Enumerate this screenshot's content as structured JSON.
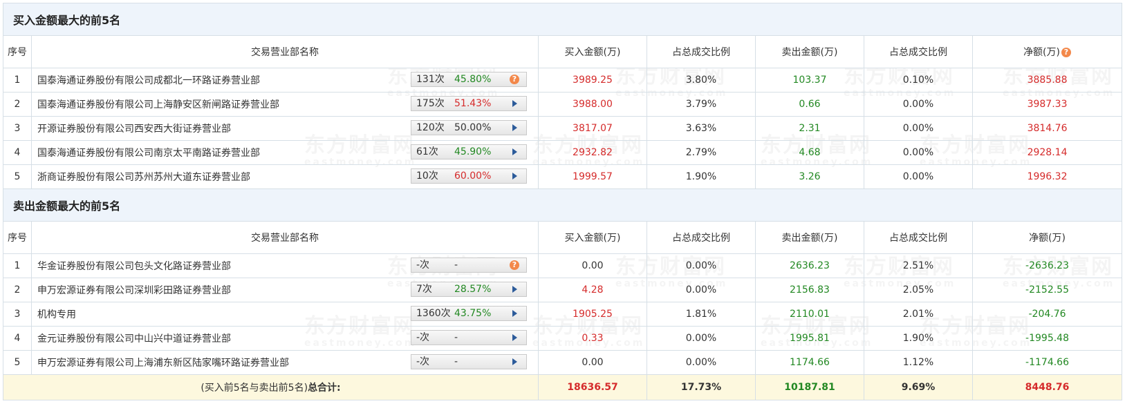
{
  "watermark": {
    "cn": "东方财富网",
    "en": "eastmoney.com"
  },
  "buy_section": {
    "title": "买入金额最大的前5名",
    "headers": [
      "序号",
      "交易营业部名称",
      "买入金额(万)",
      "占总成交比例",
      "卖出金额(万)",
      "占总成交比例",
      "净额(万)"
    ],
    "rows": [
      {
        "idx": "1",
        "name": "国泰海通证券股份有限公司成都北一环路证券营业部",
        "count": "131次",
        "pct": "45.80%",
        "pct_color": "green",
        "control": "help-icon",
        "buy": "3989.25",
        "buy_pct": "3.80%",
        "sell": "103.37",
        "sell_pct": "0.10%",
        "net": "3885.88",
        "net_color": "red"
      },
      {
        "idx": "2",
        "name": "国泰海通证券股份有限公司上海静安区新闸路证券营业部",
        "count": "175次",
        "pct": "51.43%",
        "pct_color": "red",
        "control": "play-arrow-icon",
        "buy": "3988.00",
        "buy_pct": "3.79%",
        "sell": "0.66",
        "sell_pct": "0.00%",
        "net": "3987.33",
        "net_color": "red"
      },
      {
        "idx": "3",
        "name": "开源证券股份有限公司西安西大街证券营业部",
        "count": "120次",
        "pct": "50.00%",
        "pct_color": "gray",
        "control": "play-arrow-icon",
        "buy": "3817.07",
        "buy_pct": "3.63%",
        "sell": "2.31",
        "sell_pct": "0.00%",
        "net": "3814.76",
        "net_color": "red"
      },
      {
        "idx": "4",
        "name": "国泰海通证券股份有限公司南京太平南路证券营业部",
        "count": "61次",
        "pct": "45.90%",
        "pct_color": "green",
        "control": "play-arrow-icon",
        "buy": "2932.82",
        "buy_pct": "2.79%",
        "sell": "4.68",
        "sell_pct": "0.00%",
        "net": "2928.14",
        "net_color": "red"
      },
      {
        "idx": "5",
        "name": "浙商证券股份有限公司苏州苏州大道东证券营业部",
        "count": "10次",
        "pct": "60.00%",
        "pct_color": "red",
        "control": "play-arrow-icon",
        "buy": "1999.57",
        "buy_pct": "1.90%",
        "sell": "3.26",
        "sell_pct": "0.00%",
        "net": "1996.32",
        "net_color": "red"
      }
    ]
  },
  "sell_section": {
    "title": "卖出金额最大的前5名",
    "headers": [
      "序号",
      "交易营业部名称",
      "买入金额(万)",
      "占总成交比例",
      "卖出金额(万)",
      "占总成交比例",
      "净额(万)"
    ],
    "rows": [
      {
        "idx": "1",
        "name": "华金证券股份有限公司包头文化路证券营业部",
        "count": "-次",
        "pct": "-",
        "pct_color": "gray",
        "control": "help-icon",
        "buy": "0.00",
        "buy_color": "gray",
        "buy_pct": "0.00%",
        "sell": "2636.23",
        "sell_pct": "2.51%",
        "net": "-2636.23",
        "net_color": "green"
      },
      {
        "idx": "2",
        "name": "申万宏源证券有限公司深圳彩田路证券营业部",
        "count": "7次",
        "pct": "28.57%",
        "pct_color": "green",
        "control": "play-arrow-icon",
        "buy": "4.28",
        "buy_color": "red",
        "buy_pct": "0.00%",
        "sell": "2156.83",
        "sell_pct": "2.05%",
        "net": "-2152.55",
        "net_color": "green"
      },
      {
        "idx": "3",
        "name": "机构专用",
        "count": "1360次",
        "pct": "43.75%",
        "pct_color": "green",
        "control": "play-arrow-icon",
        "buy": "1905.25",
        "buy_color": "red",
        "buy_pct": "1.81%",
        "sell": "2110.01",
        "sell_pct": "2.01%",
        "net": "-204.76",
        "net_color": "green"
      },
      {
        "idx": "4",
        "name": "金元证券股份有限公司中山兴中道证券营业部",
        "count": "-次",
        "pct": "-",
        "pct_color": "gray",
        "control": "play-arrow-icon",
        "buy": "0.33",
        "buy_color": "red",
        "buy_pct": "0.00%",
        "sell": "1995.81",
        "sell_pct": "1.90%",
        "net": "-1995.48",
        "net_color": "green"
      },
      {
        "idx": "5",
        "name": "申万宏源证券有限公司上海浦东新区陆家嘴环路证券营业部",
        "count": "-次",
        "pct": "-",
        "pct_color": "gray",
        "control": "play-arrow-icon",
        "buy": "0.00",
        "buy_color": "gray",
        "buy_pct": "0.00%",
        "sell": "1174.66",
        "sell_pct": "1.12%",
        "net": "-1174.66",
        "net_color": "green"
      }
    ]
  },
  "summary": {
    "label_prefix": "(买入前5名与卖出前5名)",
    "label_bold": "总合计:",
    "buy": "18636.57",
    "buy_pct": "17.73%",
    "sell": "10187.81",
    "sell_pct": "9.69%",
    "net": "8448.76"
  },
  "colors": {
    "red": "#d52b2b",
    "green": "#228822",
    "gray": "#333333",
    "section_bg": "#eef4fb",
    "summary_bg": "#fdf8de",
    "border": "#d6dfe6",
    "help_icon": "#f3884a",
    "arrow": "#2c5b9a"
  }
}
